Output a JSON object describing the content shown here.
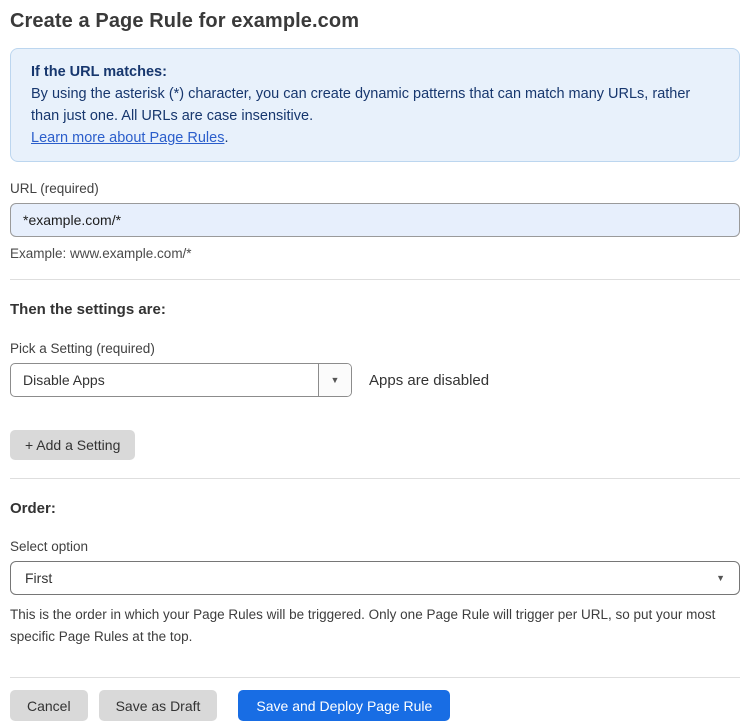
{
  "page": {
    "title": "Create a Page Rule for example.com"
  },
  "info_box": {
    "heading": "If the URL matches:",
    "body": "By using the asterisk (*) character, you can create dynamic patterns that can match many URLs, rather than just one. All URLs are case insensitive.",
    "link_label": "Learn more about Page Rules",
    "link_suffix": "."
  },
  "url_field": {
    "label": "URL (required)",
    "value": "*example.com/*",
    "example": "Example: www.example.com/*"
  },
  "settings_section": {
    "heading": "Then the settings are:",
    "setting_label": "Pick a Setting (required)",
    "setting_value": "Disable Apps",
    "setting_status": "Apps are disabled",
    "add_setting_label": "+ Add a Setting"
  },
  "order_section": {
    "heading": "Order:",
    "select_label": "Select option",
    "select_value": "First",
    "help_text": "This is the order in which your Page Rules will be triggered. Only one Page Rule will trigger per URL, so put your most specific Page Rules at the top."
  },
  "footer": {
    "cancel_label": "Cancel",
    "save_draft_label": "Save as Draft",
    "save_deploy_label": "Save and Deploy Page Rule"
  },
  "colors": {
    "accent_blue": "#186de4",
    "info_box_bg": "#e8f1fb",
    "info_box_border": "#bcd6ef",
    "info_text": "#17376e",
    "link_blue": "#2b5ecb",
    "url_input_bg": "#e7effc",
    "button_gray": "#d9d9d9"
  },
  "icons": {
    "dropdown_arrow": "▼"
  }
}
